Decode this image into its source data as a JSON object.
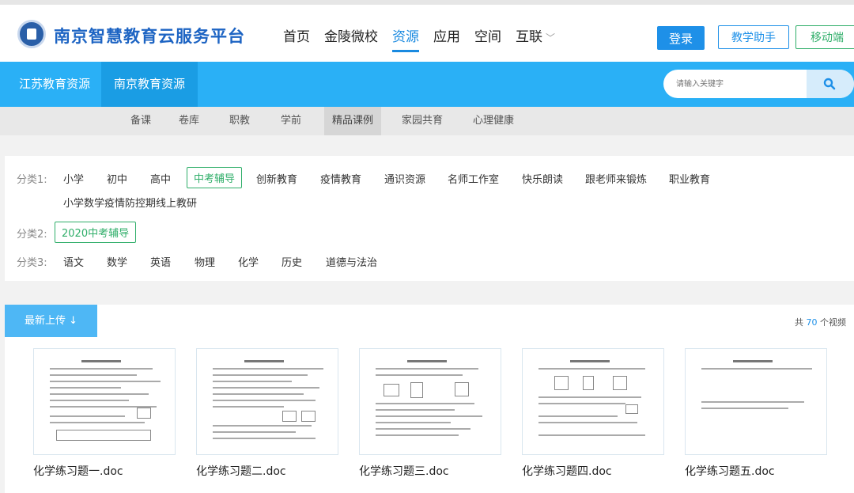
{
  "header": {
    "brand": "南京智慧教育云服务平台",
    "nav": [
      {
        "label": "首页",
        "active": false
      },
      {
        "label": "金陵微校",
        "active": false
      },
      {
        "label": "资源",
        "active": true
      },
      {
        "label": "应用",
        "active": false
      },
      {
        "label": "空间",
        "active": false
      },
      {
        "label": "互联",
        "active": false
      }
    ],
    "login_label": "登录",
    "assist_label": "教学助手",
    "mobile_label": "移动端"
  },
  "bluebar": {
    "tabs": [
      "江苏教育资源",
      "南京教育资源"
    ],
    "search_placeholder": "请输入关键字"
  },
  "subnav": {
    "items": [
      "备课",
      "卷库",
      "职教",
      "学前",
      "精品课例",
      "家园共育",
      "心理健康"
    ],
    "active": "精品课例"
  },
  "filters": {
    "row1_label": "分类1:",
    "row1": [
      "小学",
      "初中",
      "高中",
      "中考辅导",
      "创新教育",
      "疫情教育",
      "通识资源",
      "名师工作室",
      "快乐朗读",
      "跟老师来锻炼",
      "职业教育"
    ],
    "row1_extra": "小学数学疫情防控期线上教研",
    "row1_selected": "中考辅导",
    "row2_label": "分类2:",
    "row2": [
      "2020中考辅导"
    ],
    "row3_label": "分类3:",
    "row3": [
      "语文",
      "数学",
      "英语",
      "物理",
      "化学",
      "历史",
      "道德与法治"
    ]
  },
  "results": {
    "sort_label": "最新上传",
    "count_prefix": "共",
    "count": "70",
    "count_suffix": "个视频",
    "items": [
      "化学练习题一.doc",
      "化学练习题二.doc",
      "化学练习题三.doc",
      "化学练习题四.doc",
      "化学练习题五.doc"
    ]
  }
}
